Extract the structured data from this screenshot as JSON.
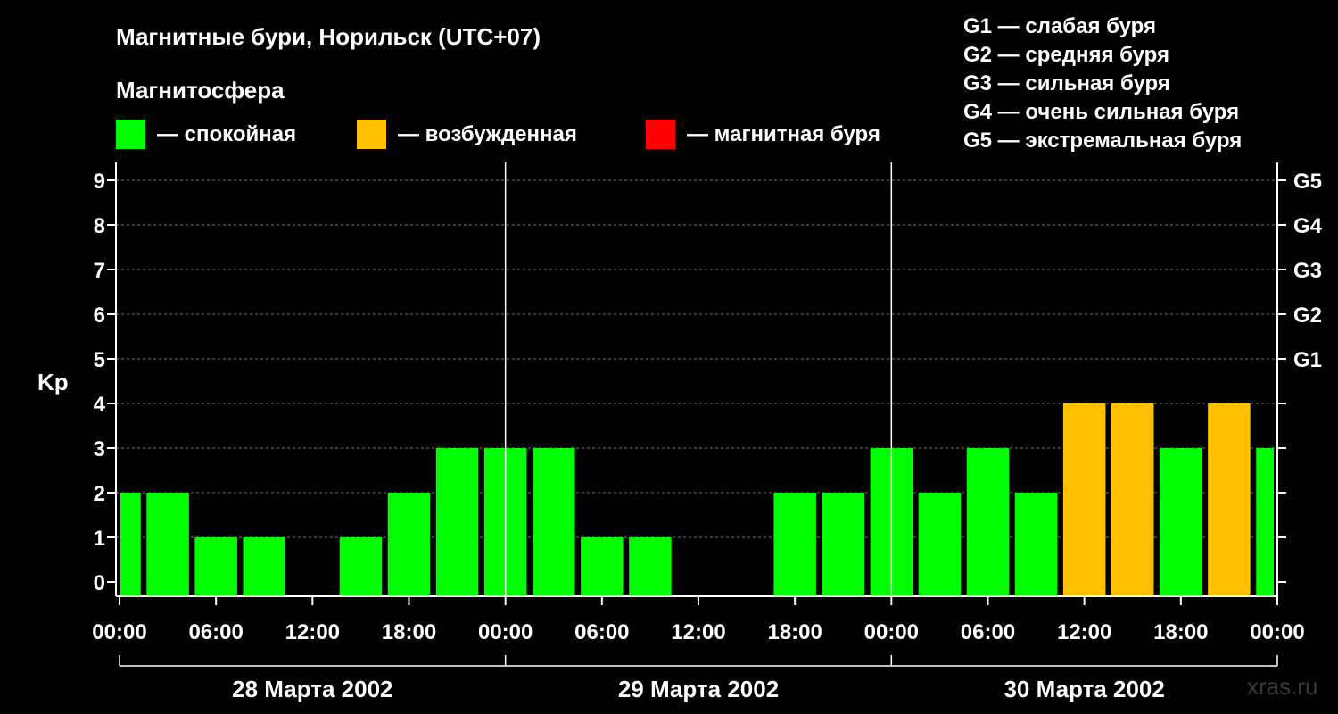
{
  "title": "Магнитные бури, Норильск (UTC+07)",
  "legend": {
    "heading": "Магнитосфера",
    "items": [
      {
        "label": "— спокойная",
        "color": "#00ff00"
      },
      {
        "label": "— возбужденная",
        "color": "#ffc000"
      },
      {
        "label": "— магнитная буря",
        "color": "#ff0000"
      }
    ]
  },
  "g_scale": [
    "G1 — слабая буря",
    "G2 — средняя буря",
    "G3 — сильная буря",
    "G4 — очень сильная буря",
    "G5 — экстремальная буря"
  ],
  "credit": "xras.ru",
  "chart_data": {
    "type": "bar",
    "ylabel": "Kp",
    "ylim": [
      0,
      9
    ],
    "y_ticks": [
      "0",
      "1",
      "2",
      "3",
      "4",
      "5",
      "6",
      "7",
      "8",
      "9"
    ],
    "right_ticks": [
      {
        "kp": 5,
        "label": "G1"
      },
      {
        "kp": 6,
        "label": "G2"
      },
      {
        "kp": 7,
        "label": "G3"
      },
      {
        "kp": 8,
        "label": "G4"
      },
      {
        "kp": 9,
        "label": "G5"
      }
    ],
    "x_tick_labels": [
      "00:00",
      "06:00",
      "12:00",
      "18:00",
      "00:00",
      "06:00",
      "12:00",
      "18:00",
      "00:00",
      "06:00",
      "12:00",
      "18:00",
      "00:00"
    ],
    "dates": [
      "28 Марта 2002",
      "29 Марта 2002",
      "30 Марта 2002"
    ],
    "grid": true,
    "interval_hours": 3,
    "values": [
      2,
      2,
      1,
      1,
      0,
      1,
      2,
      3,
      3,
      3,
      1,
      1,
      0,
      0,
      2,
      2,
      3,
      2,
      3,
      2,
      4,
      4,
      3,
      4,
      3
    ],
    "colors": [
      "#00ff00",
      "#00ff00",
      "#00ff00",
      "#00ff00",
      "#00ff00",
      "#00ff00",
      "#00ff00",
      "#00ff00",
      "#00ff00",
      "#00ff00",
      "#00ff00",
      "#00ff00",
      "#00ff00",
      "#00ff00",
      "#00ff00",
      "#00ff00",
      "#00ff00",
      "#00ff00",
      "#00ff00",
      "#00ff00",
      "#ffc000",
      "#ffc000",
      "#00ff00",
      "#ffc000",
      "#00ff00"
    ]
  }
}
